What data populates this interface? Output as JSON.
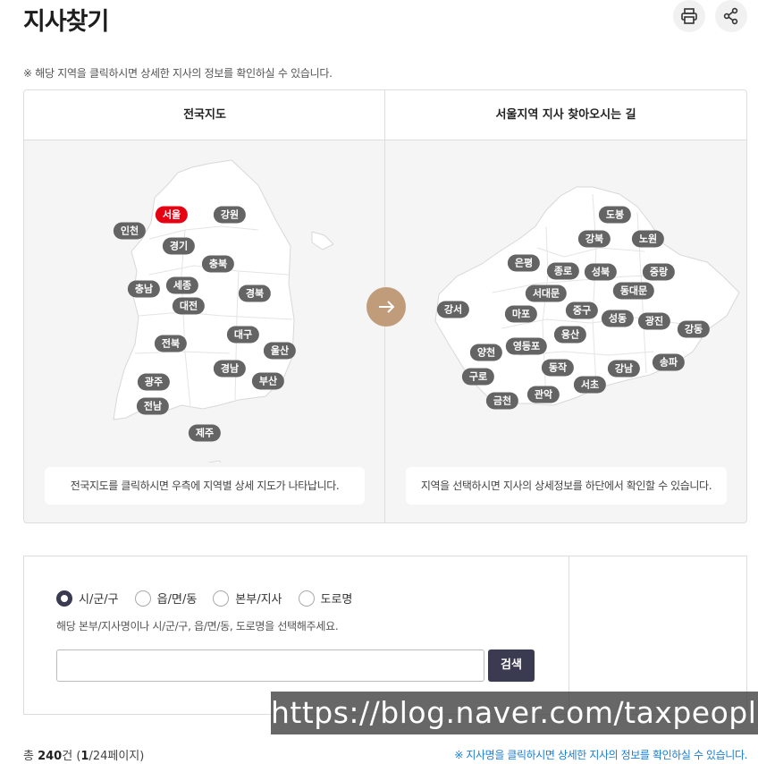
{
  "page": {
    "title": "지사찾기",
    "notice": "※ 해당 지역을 클릭하시면 상세한 지사의 정보를 확인하실 수 있습니다."
  },
  "icons": {
    "print": "print-icon",
    "share": "share-icon",
    "arrow": "arrow-right-icon"
  },
  "map": {
    "left_title": "전국지도",
    "right_title": "서울지역 지사 찾아오시는 길",
    "left_caption": "전국지도를 클릭하시면 우측에 지역별 상세 지도가 나타납니다.",
    "right_caption": "지역을 선택하시면 지사의 상세정보를 하단에서 확인할 수 있습니다.",
    "national_regions": [
      "서울",
      "강원",
      "인천",
      "경기",
      "충북",
      "충남",
      "세종",
      "경북",
      "대전",
      "대구",
      "전북",
      "울산",
      "경남",
      "광주",
      "부산",
      "전남",
      "제주"
    ],
    "seoul_districts": [
      "도봉",
      "강북",
      "노원",
      "은평",
      "종로",
      "성북",
      "중랑",
      "서대문",
      "동대문",
      "강서",
      "마포",
      "중구",
      "성동",
      "광진",
      "강동",
      "용산",
      "양천",
      "영등포",
      "송파",
      "동작",
      "강남",
      "구로",
      "서초",
      "관악",
      "금천"
    ],
    "active_region": "서울"
  },
  "search": {
    "radios": [
      {
        "label": "시/군/구",
        "checked": true
      },
      {
        "label": "읍/면/동",
        "checked": false
      },
      {
        "label": "본부/지사",
        "checked": false
      },
      {
        "label": "도로명",
        "checked": false
      }
    ],
    "hint": "해당 본부/지사명이나 시/군/구, 읍/면/동, 도로명을 선택해주세요.",
    "input_value": "",
    "button_label": "검색"
  },
  "results": {
    "total_prefix": "총 ",
    "total_count": "240",
    "total_unit": "건 (",
    "current_page": "1",
    "page_suffix": "/24페이지)",
    "note": "※ 지사명을 클릭하시면 상세한 지사의 정보를 확인하실 수 있습니다."
  },
  "watermark": "https://blog.naver.com/taxpeoples",
  "colors": {
    "active": "#e60012",
    "pill": "#646464",
    "accent_button": "#3a3a50",
    "arrow_button": "#c19c7a",
    "note": "#1a7fd4"
  }
}
